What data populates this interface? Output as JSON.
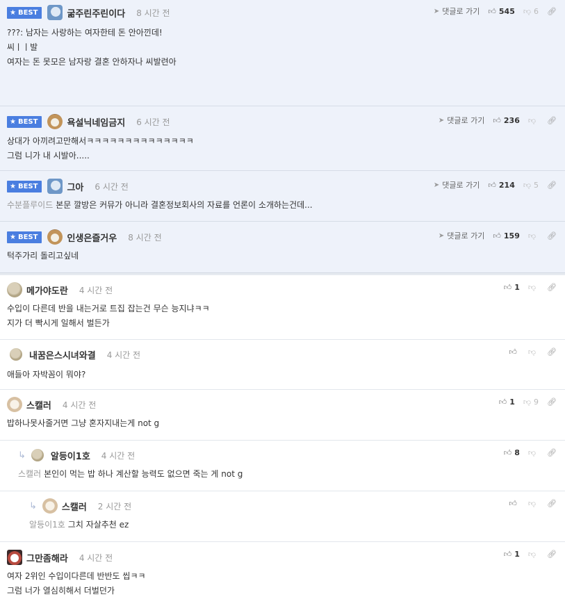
{
  "labels": {
    "best": "BEST",
    "goto_reply": "댓글로 가기"
  },
  "best_comments": [
    {
      "nickname": "굶주린주린이다",
      "time": "8 시간 전",
      "up": "545",
      "down": "6",
      "lines": [
        "???: 남자는 사랑하는 여자한테 돈 안아낀데!",
        "",
        "씨ㅣㅣ발",
        "",
        "여자는 돈 못모은 남자랑 결혼 안하자나 씨발련아"
      ]
    },
    {
      "nickname": "욕설닉네임금지",
      "time": "6 시간 전",
      "up": "236",
      "down": "",
      "lines": [
        "상대가 아끼려고만해서ㅋㅋㅋㅋㅋㅋㅋㅋㅋㅋㅋㅋㅋㅋ",
        "그럼 니가 내 시발아....."
      ]
    },
    {
      "nickname": "그아",
      "time": "6 시간 전",
      "up": "214",
      "down": "5",
      "mention": "수분플루이드",
      "lines": [
        "본문 깔방은 커뮤가 아니라 결혼정보회사의 자료를 언론이 소개하는건데..."
      ]
    },
    {
      "nickname": "인생은즐거우",
      "time": "8 시간 전",
      "up": "159",
      "down": "",
      "lines": [
        "턱주가리 돌리고싶네"
      ]
    }
  ],
  "comments": [
    {
      "nickname": "메가야도란",
      "time": "4 시간 전",
      "up": "1",
      "down": "",
      "lines": [
        "수입이 다른데 반을 내는거로 트집 잡는건 무슨 능지냐ㅋㅋ",
        "지가 더 빡시게 일해서 벌든가"
      ]
    },
    {
      "nickname": "내꿈은스시녀와결",
      "time": "4 시간 전",
      "up": "",
      "down": "",
      "lines": [
        "애들아 자박꼼이 뭐야?"
      ]
    },
    {
      "nickname": "스캘러",
      "time": "4 시간 전",
      "up": "1",
      "down": "9",
      "lines": [
        "밥하나못사줄거면 그냥 혼자지내는게 not g"
      ]
    },
    {
      "nickname": "알등이1호",
      "time": "4 시간 전",
      "up": "8",
      "down": "",
      "mention": "스캘러",
      "lines": [
        "본인이 먹는 밥 하나 계산할 능력도 없으면 죽는 게 not g"
      ]
    },
    {
      "nickname": "스캘러",
      "time": "2 시간 전",
      "up": "",
      "down": "",
      "mention": "알등이1호",
      "lines": [
        "그치 자살추천 ez"
      ]
    },
    {
      "nickname": "그만좀해라",
      "time": "4 시간 전",
      "up": "1",
      "down": "",
      "lines": [
        "여자 2위인 수입이다른데 반반도 씹ㅋㅋ",
        "그럼 너가 열심히해서 더벌던가"
      ]
    }
  ]
}
